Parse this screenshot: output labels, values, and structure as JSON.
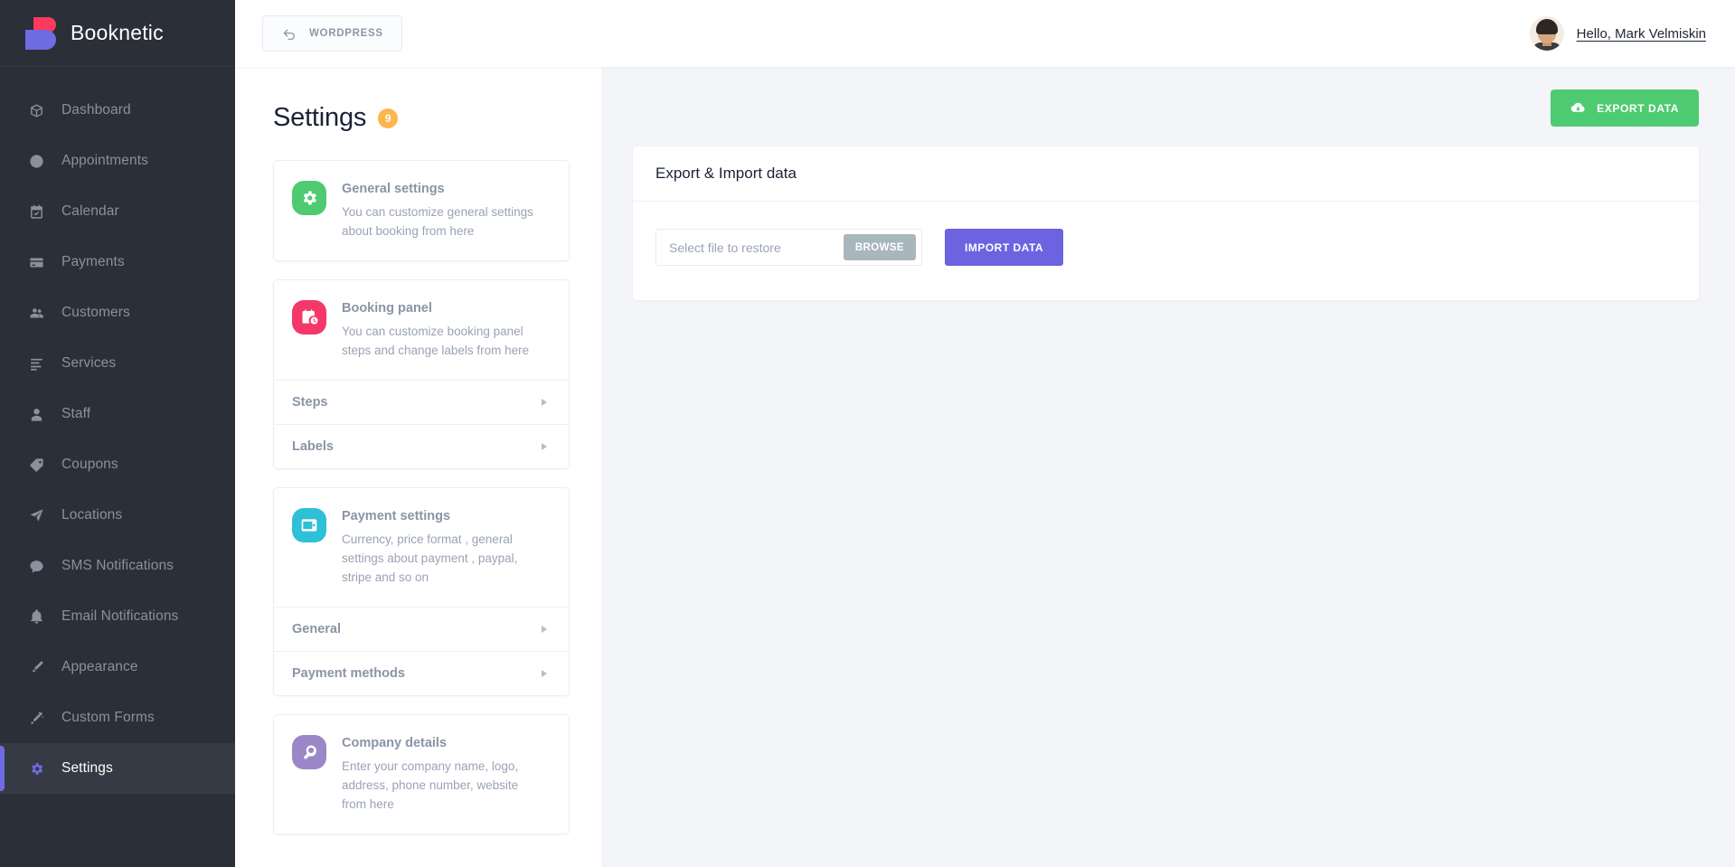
{
  "sidebar": {
    "brand": {
      "name": "Booknetic",
      "logo_icon": "booknetic-logo"
    },
    "items": [
      {
        "label": "Dashboard",
        "icon": "box-icon",
        "active": false
      },
      {
        "label": "Appointments",
        "icon": "clock-icon",
        "active": false
      },
      {
        "label": "Calendar",
        "icon": "calendar-check-icon",
        "active": false
      },
      {
        "label": "Payments",
        "icon": "wallet-icon",
        "active": false
      },
      {
        "label": "Customers",
        "icon": "users-icon",
        "active": false
      },
      {
        "label": "Services",
        "icon": "list-icon",
        "active": false
      },
      {
        "label": "Staff",
        "icon": "user-icon",
        "active": false
      },
      {
        "label": "Coupons",
        "icon": "tag-icon",
        "active": false
      },
      {
        "label": "Locations",
        "icon": "paper-plane-icon",
        "active": false
      },
      {
        "label": "SMS Notifications",
        "icon": "chat-bubble-icon",
        "active": false
      },
      {
        "label": "Email Notifications",
        "icon": "bell-icon",
        "active": false
      },
      {
        "label": "Appearance",
        "icon": "brush-icon",
        "active": false
      },
      {
        "label": "Custom Forms",
        "icon": "magic-wand-icon",
        "active": false
      },
      {
        "label": "Settings",
        "icon": "gear-icon",
        "active": true
      }
    ]
  },
  "topbar": {
    "wordpress_button": {
      "label": "WORDPRESS",
      "icon": "back-arrow-icon"
    },
    "user": {
      "greeting": "Hello, Mark Velmiskin",
      "avatar_icon": "user-avatar"
    }
  },
  "settings_column": {
    "title": "Settings",
    "badge": "9",
    "cards": [
      {
        "title": "General settings",
        "desc": "You can customize general settings about booking from here",
        "icon": "gear-icon",
        "color": "#4ecb71",
        "sub_items": []
      },
      {
        "title": "Booking panel",
        "desc": "You can customize booking panel steps and change labels from here",
        "icon": "calendar-clock-icon",
        "color": "#f5386a",
        "sub_items": [
          {
            "label": "Steps",
            "caret": "caret-right-icon"
          },
          {
            "label": "Labels",
            "caret": "caret-right-icon"
          }
        ]
      },
      {
        "title": "Payment settings",
        "desc": "Currency, price format , general settings about payment , paypal, stripe and so on",
        "icon": "wallet-icon",
        "color": "#2ec0d6",
        "sub_items": [
          {
            "label": "General",
            "caret": "caret-right-icon"
          },
          {
            "label": "Payment methods",
            "caret": "caret-right-icon"
          }
        ]
      },
      {
        "title": "Company details",
        "desc": "Enter your company name, logo, address, phone number, website from here",
        "icon": "bulb-idea-icon",
        "color": "#9b87c8",
        "sub_items": []
      }
    ]
  },
  "main": {
    "export_button": {
      "label": "EXPORT DATA",
      "icon": "cloud-download-icon",
      "color": "#4ecb71"
    },
    "panel": {
      "title": "Export & Import data",
      "file_field_placeholder": "Select file to restore",
      "browse_button": "BROWSE",
      "import_button": "IMPORT DATA",
      "import_button_color": "#6c63e0"
    }
  }
}
